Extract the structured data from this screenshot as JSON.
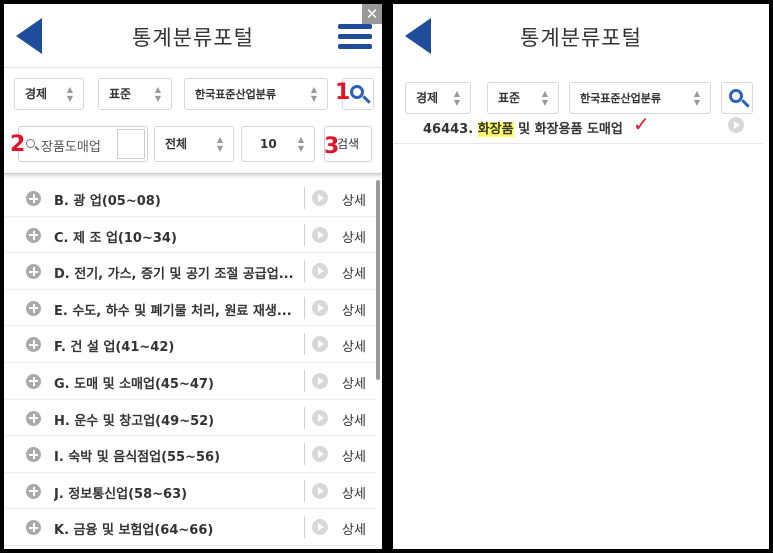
{
  "app": {
    "title": "통계분류포털"
  },
  "filters": {
    "type": "경제",
    "standard": "표준",
    "classification": "한국표준산업분류"
  },
  "search": {
    "query": "장품도매업",
    "scope": "전체",
    "count": "10",
    "button_label": "검색"
  },
  "annotations": [
    "1",
    "2",
    "3"
  ],
  "list": {
    "detail_label": "상세",
    "items": [
      "B. 광 업(05~08)",
      "C. 제 조 업(10~34)",
      "D. 전기, 가스, 증기 및 공기 조절 공급업...",
      "E. 수도, 하수 및 폐기물 처리, 원료 재생...",
      "F. 건 설 업(41~42)",
      "G. 도매 및 소매업(45~47)",
      "H. 운수 및 창고업(49~52)",
      "I. 숙박 및 음식점업(55~56)",
      "J. 정보통신업(58~63)",
      "K. 금융 및 보험업(64~66)"
    ]
  },
  "result": {
    "code": "46443.",
    "highlight": "화장품",
    "rest": "및 화장용품 도매업",
    "check": "✓"
  },
  "icons": {
    "back": "back-arrow-icon",
    "menu": "hamburger-menu-icon",
    "search": "search-icon",
    "expand": "plus-circle-icon",
    "detail": "play-circle-icon"
  },
  "colors": {
    "brand": "#1f4d9b",
    "annotation": "#e0152a",
    "highlight": "#ffff66"
  }
}
